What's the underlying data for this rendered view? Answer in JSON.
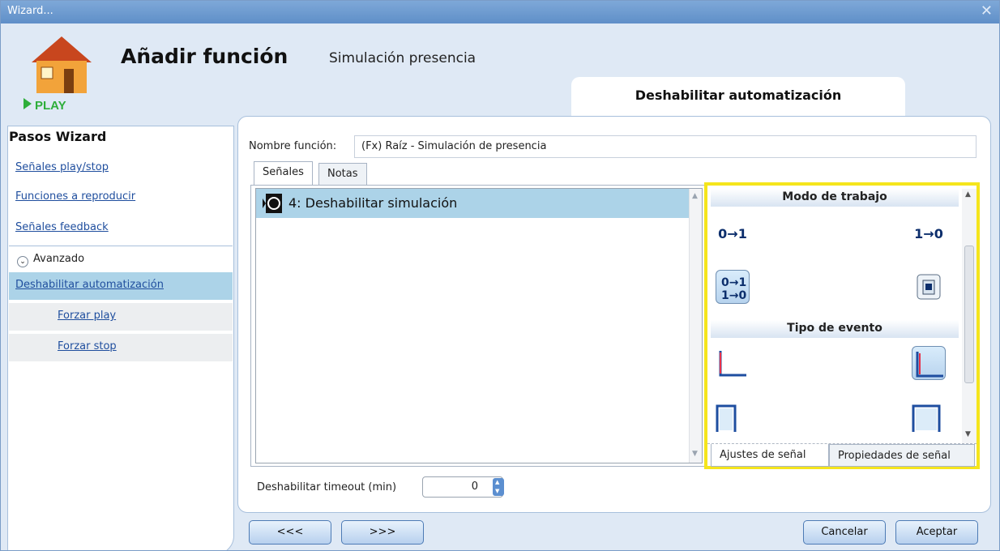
{
  "window": {
    "title": "Wizard..."
  },
  "header": {
    "logo_text": "PLAY",
    "title": "Añadir función",
    "subtitle": "Simulación presencia",
    "current_step": "Deshabilitar automatización"
  },
  "sidebar": {
    "title": "Pasos Wizard",
    "items": [
      {
        "label": "Señales play/stop"
      },
      {
        "label": "Funciones a reproducir"
      },
      {
        "label": "Señales feedback"
      }
    ],
    "advanced_label": "Avanzado",
    "advanced_items": [
      {
        "label": "Deshabilitar automatización"
      },
      {
        "label": "Forzar play"
      },
      {
        "label": "Forzar stop"
      }
    ]
  },
  "main": {
    "name_label": "Nombre función:",
    "name_value": "(Fx) Raíz - Simulación de presencia",
    "tabs": [
      "Señales",
      "Notas"
    ],
    "signals": [
      {
        "label": "4: Deshabilitar simulación"
      }
    ],
    "right_panel": {
      "mode_title": "Modo de trabajo",
      "modes": [
        "0→1",
        "1→0"
      ],
      "event_title": "Tipo de evento",
      "tabs": [
        "Ajustes de señal",
        "Propiedades de señal"
      ]
    },
    "timeout_label": "Deshabilitar timeout (min)",
    "timeout_value": "0"
  },
  "footer": {
    "prev": "<<<",
    "next": ">>>",
    "cancel": "Cancelar",
    "accept": "Aceptar"
  }
}
